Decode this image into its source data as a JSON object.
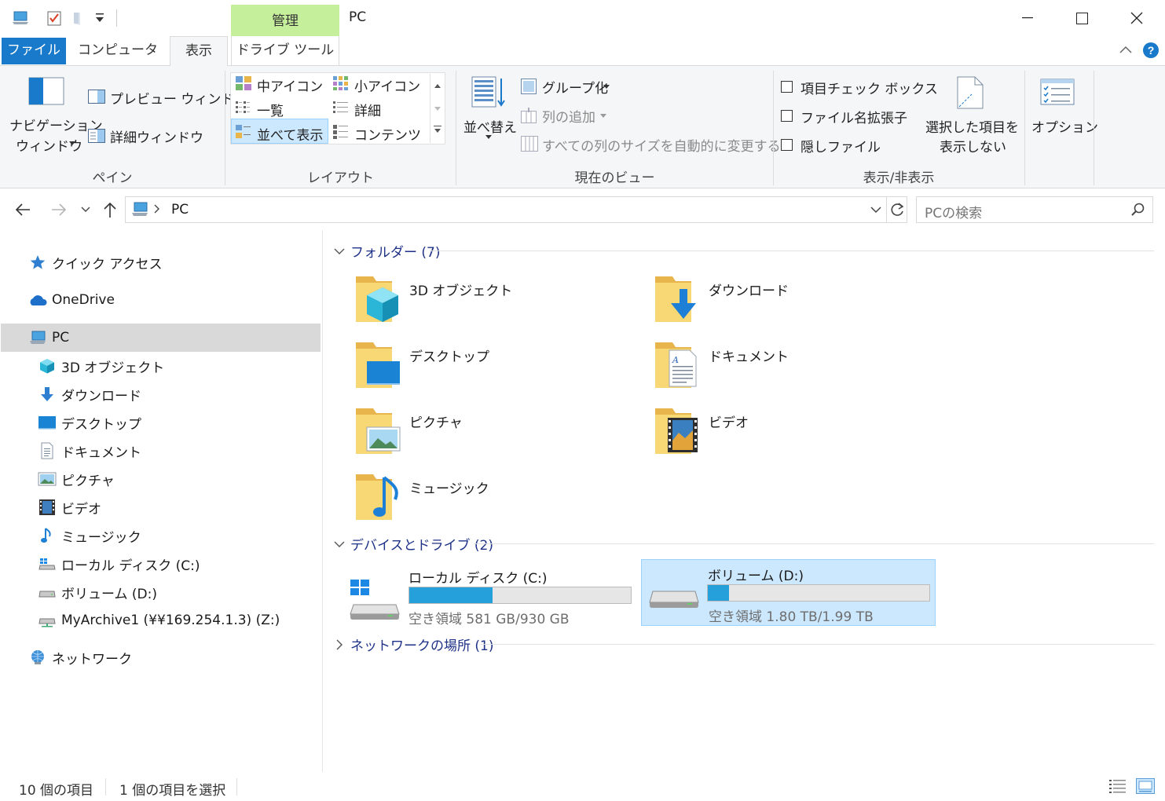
{
  "window": {
    "title": "PC",
    "contextual_tab_group": "管理"
  },
  "ribbon_tabs": {
    "file": "ファイル",
    "computer": "コンピューター",
    "view": "表示",
    "drive_tools": "ドライブ ツール"
  },
  "ribbon": {
    "pane": {
      "navigation_line1": "ナビゲーション",
      "navigation_line2": "ウィンドウ",
      "preview": "プレビュー ウィンドウ",
      "details": "詳細ウィンドウ",
      "label": "ペイン"
    },
    "layout": {
      "medium_icons": "中アイコン",
      "small_icons": "小アイコン",
      "list": "一覧",
      "details": "詳細",
      "tiles": "並べて表示",
      "content": "コンテンツ",
      "label": "レイアウト"
    },
    "current_view": {
      "sort": "並べ替え",
      "group_by": "グループ化",
      "add_columns": "列の追加",
      "size_all_columns": "すべての列のサイズを自動的に変更する",
      "label": "現在のビュー"
    },
    "show_hide": {
      "item_checkboxes": "項目チェック ボックス",
      "file_extensions": "ファイル名拡張子",
      "hidden_items": "隠しファイル",
      "hide_selected_line1": "選択した項目を",
      "hide_selected_line2": "表示しない",
      "label": "表示/非表示"
    },
    "options": "オプション"
  },
  "address": {
    "path": "PC",
    "search_placeholder": "PCの検索"
  },
  "nav_pane": {
    "quick_access": "クイック アクセス",
    "onedrive": "OneDrive",
    "pc": "PC",
    "items": [
      "3D オブジェクト",
      "ダウンロード",
      "デスクトップ",
      "ドキュメント",
      "ピクチャ",
      "ビデオ",
      "ミュージック",
      "ローカル ディスク (C:)",
      "ボリューム (D:)",
      "MyArchive1 (¥¥169.254.1.3) (Z:)"
    ],
    "network": "ネットワーク"
  },
  "content": {
    "folders_header": "フォルダー (7)",
    "folders": [
      "3D オブジェクト",
      "ダウンロード",
      "デスクトップ",
      "ドキュメント",
      "ピクチャ",
      "ビデオ",
      "ミュージック"
    ],
    "devices_header": "デバイスとドライブ (2)",
    "drives": [
      {
        "name": "ローカル ディスク (C:)",
        "free": "空き領域 581 GB/930 GB",
        "used_fraction": 0.375
      },
      {
        "name": "ボリューム (D:)",
        "free": "空き領域 1.80 TB/1.99 TB",
        "used_fraction": 0.095
      }
    ],
    "network_header": "ネットワークの場所 (1)"
  },
  "status": {
    "item_count": "10 個の項目",
    "selected": "1 個の項目を選択"
  },
  "colors": {
    "accent": "#1979ca",
    "manage_tab": "#c6ef9c",
    "selection": "#cce8ff",
    "drive_bar": "#26a0da",
    "group_header": "#1e3287"
  }
}
